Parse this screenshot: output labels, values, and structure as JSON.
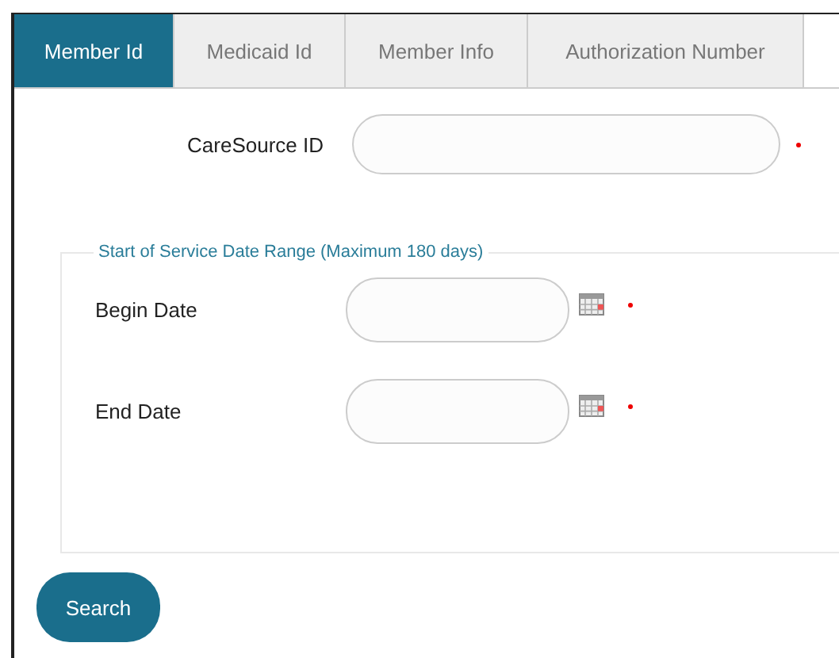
{
  "tabs": [
    {
      "label": "Member Id",
      "selected": true
    },
    {
      "label": "Medicaid Id",
      "selected": false
    },
    {
      "label": "Member Info",
      "selected": false
    },
    {
      "label": "Authorization Number",
      "selected": false
    }
  ],
  "id_field": {
    "label": "CareSource ID",
    "required": true
  },
  "date_range": {
    "legend": "Start of Service Date Range (Maximum 180 days)",
    "fields": [
      {
        "label": "Begin Date",
        "required": true
      },
      {
        "label": "End Date",
        "required": true
      }
    ]
  },
  "search_button": "Search"
}
